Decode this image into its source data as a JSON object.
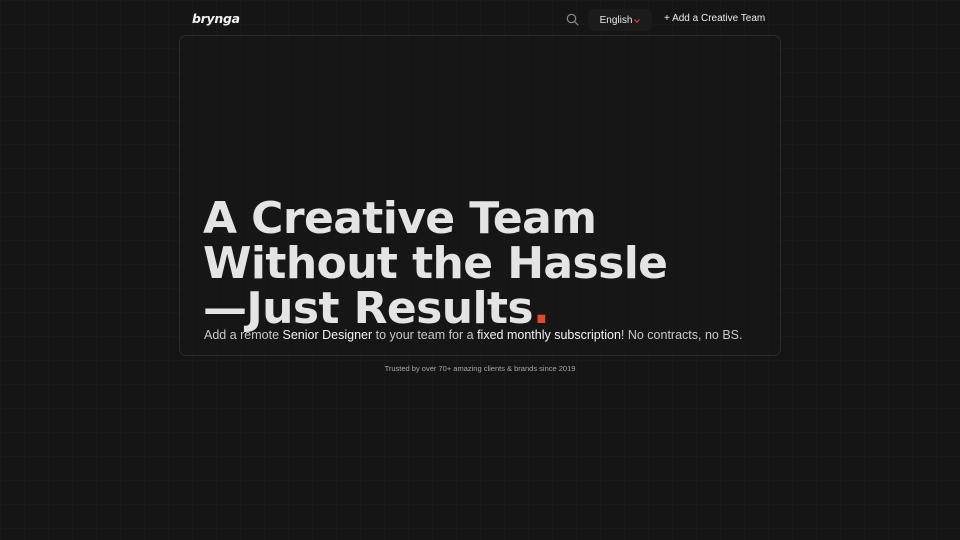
{
  "nav": {
    "logo": "brynga",
    "search_icon": "search-icon",
    "language": "English",
    "language_icon": "chevron-down-icon",
    "cta_label": "+ Add a Creative Team"
  },
  "hero": {
    "headline_line1": "A Creative Team",
    "headline_line2": "Without the Hassle",
    "headline_line3": "—Just Results",
    "headline_dot": ".",
    "sub_1": "Add a remote ",
    "sub_2": "Senior Designer",
    "sub_3": " to your team for a ",
    "sub_4": "fixed monthly subscription",
    "sub_5": "! No contracts, no BS."
  },
  "trusted": "Trusted by over 70+ amazing clients & brands since 2019",
  "colors": {
    "background": "#151515",
    "accent": "#e24a2c",
    "text": "#e4e4e4"
  }
}
